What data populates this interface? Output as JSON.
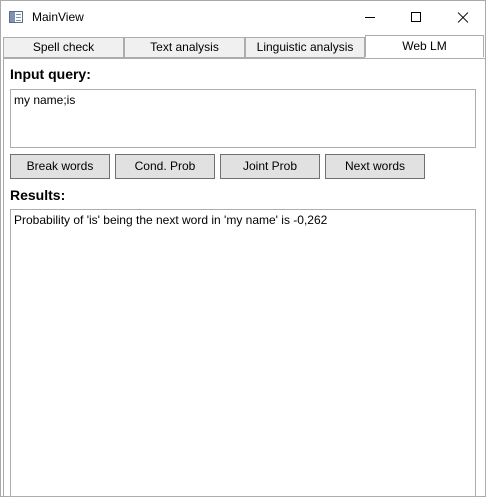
{
  "window": {
    "title": "MainView"
  },
  "tabs": [
    {
      "label": "Spell check"
    },
    {
      "label": "Text analysis"
    },
    {
      "label": "Linguistic analysis"
    },
    {
      "label": "Web LM",
      "active": true
    }
  ],
  "query": {
    "label": "Input query:",
    "value": "my name;is"
  },
  "buttons": {
    "break_words": "Break words",
    "cond_prob": "Cond. Prob",
    "joint_prob": "Joint Prob",
    "next_words": "Next words"
  },
  "results": {
    "label": "Results:",
    "text": "Probability of 'is' being the next word in 'my name' is -0,262"
  }
}
